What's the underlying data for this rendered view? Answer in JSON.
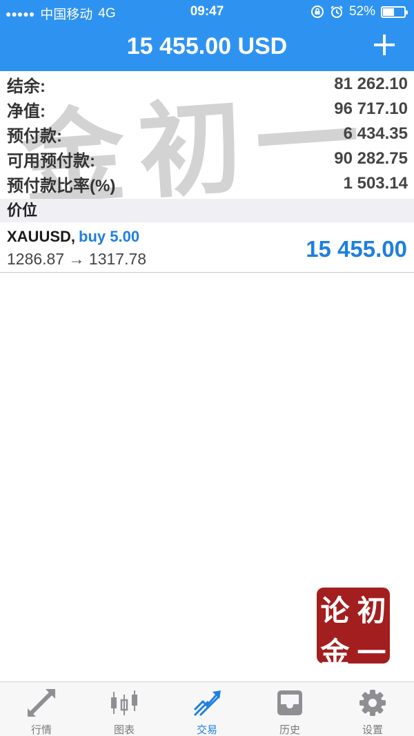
{
  "status_bar": {
    "signal": "●●●●●",
    "carrier": "中国移动",
    "network": "4G",
    "time": "09:47",
    "battery": "52%",
    "battery_level": 0.52
  },
  "header": {
    "title": "15 455.00 USD",
    "add_icon": "plus-icon"
  },
  "summary": [
    {
      "label": "结余:",
      "value": "81 262.10"
    },
    {
      "label": "净值:",
      "value": "96 717.10"
    },
    {
      "label": "预付款:",
      "value": "6 434.35"
    },
    {
      "label": "可用预付款:",
      "value": "90 282.75"
    },
    {
      "label": "预付款比率(%)",
      "value": "1 503.14"
    }
  ],
  "watermark": "金初一",
  "section": {
    "title": "价位"
  },
  "positions": [
    {
      "symbol": "XAUUSD,",
      "direction": "buy 5.00",
      "prices": "1286.87 → 1317.78",
      "profit": "15 455.00"
    }
  ],
  "seal": {
    "chars": [
      "论",
      "初",
      "金",
      "一"
    ]
  },
  "tabs": [
    {
      "label": "行情",
      "icon": "quotes-arrows-icon",
      "active": false
    },
    {
      "label": "图表",
      "icon": "candlestick-chart-icon",
      "active": false
    },
    {
      "label": "交易",
      "icon": "trade-trend-icon",
      "active": true
    },
    {
      "label": "历史",
      "icon": "history-inbox-icon",
      "active": false
    },
    {
      "label": "设置",
      "icon": "gear-icon",
      "active": false
    }
  ],
  "colors": {
    "accent": "#2e93f0",
    "profit": "#1e7fe0",
    "seal": "#a31e1e",
    "inactive": "#8e8e93"
  }
}
